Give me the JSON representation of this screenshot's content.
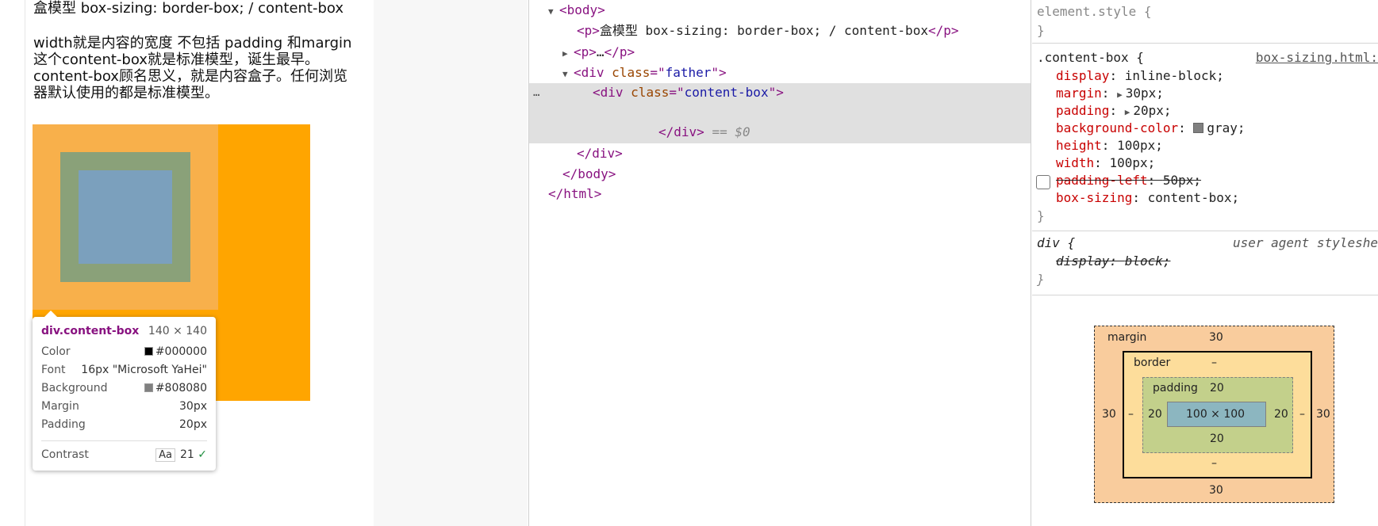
{
  "page": {
    "title": "盒模型 box-sizing: border-box; / content-box",
    "paragraph": "width就是内容的宽度 不包括 padding 和margin 这个content-box就是标准模型，诞生最早。content-box顾名思义，就是内容盒子。任何浏览器默认使用的都是标准模型。"
  },
  "tooltip": {
    "tag": "div.content-box",
    "size": "140 × 140",
    "rows": [
      {
        "label": "Color",
        "value": "#000000",
        "swatch": "#000000"
      },
      {
        "label": "Font",
        "value": "16px \"Microsoft YaHei\""
      },
      {
        "label": "Background",
        "value": "#808080",
        "swatch": "#808080"
      },
      {
        "label": "Margin",
        "value": "30px"
      },
      {
        "label": "Padding",
        "value": "20px"
      }
    ],
    "contrast_label": "Contrast",
    "contrast_aa": "Aa",
    "contrast_value": "21",
    "contrast_check": "✓"
  },
  "elements": {
    "body_open": "body",
    "p1_text": "盒模型 box-sizing: border-box; / content-box",
    "p2_ellipsis": "…",
    "father_class": "father",
    "content_class": "content-box",
    "selected_marker": "== $0",
    "dots": "…"
  },
  "styles": {
    "element_style": "element.style {",
    "close_brace": "}",
    "rule1_selector": ".content-box {",
    "rule1_source": "box-sizing.html:",
    "rule1_props": [
      {
        "name": "display",
        "value": "inline-block;"
      },
      {
        "name": "margin",
        "value": "30px;"
      },
      {
        "name": "padding",
        "value": "20px;"
      },
      {
        "name": "background-color",
        "value": "gray;"
      },
      {
        "name": "height",
        "value": "100px;"
      },
      {
        "name": "width",
        "value": "100px;"
      },
      {
        "name": "padding-left",
        "value": "50px;"
      },
      {
        "name": "box-sizing",
        "value": "content-box;"
      }
    ],
    "rule2_selector": "div {",
    "rule2_source": "user agent styleshe",
    "rule2_props": [
      {
        "name": "display",
        "value": "block;"
      }
    ]
  },
  "box_model": {
    "margin_label": "margin",
    "margin_top": "30",
    "margin_bottom": "30",
    "margin_left": "30",
    "margin_right": "30",
    "border_label": "border",
    "border_top": "–",
    "border_bottom": "–",
    "border_left": "–",
    "border_right": "–",
    "padding_label": "padding",
    "padding_top": "20",
    "padding_bottom": "20",
    "padding_left": "20",
    "padding_right": "20",
    "content": "100 × 100"
  }
}
